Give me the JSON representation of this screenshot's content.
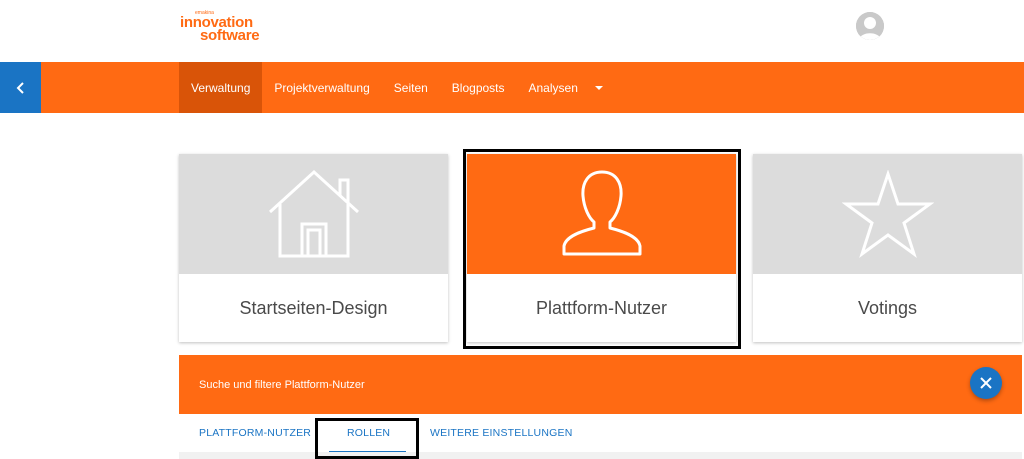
{
  "brand": {
    "small": "emakina",
    "line1": "innovation",
    "line2": "software",
    "color": "#ff6a13"
  },
  "nav": {
    "back_icon": "chevron-left-icon",
    "items": [
      {
        "label": "Verwaltung",
        "active": true
      },
      {
        "label": "Projektverwaltung"
      },
      {
        "label": "Seiten"
      },
      {
        "label": "Blogposts"
      },
      {
        "label": "Analysen"
      }
    ],
    "dropdown_icon": "caret-down-icon"
  },
  "tiles": [
    {
      "label": "Startseiten-Design",
      "icon": "house-icon"
    },
    {
      "label": "Plattform-Nutzer",
      "icon": "user-bust-icon",
      "active": true
    },
    {
      "label": "Votings",
      "icon": "star-icon"
    }
  ],
  "filter": {
    "title": "Suche und filtere Plattform-Nutzer",
    "close_icon": "close-icon"
  },
  "tabs": [
    {
      "label": "PLATTFORM-NUTZER"
    },
    {
      "label": "ROLLEN",
      "active": true
    },
    {
      "label": "WEITERE EINSTELLUNGEN"
    }
  ],
  "colors": {
    "accent": "#ff6a13",
    "accent_dark": "#d95408",
    "primary_blue": "#1a74c4",
    "tile_gray": "#dcdcdc"
  }
}
